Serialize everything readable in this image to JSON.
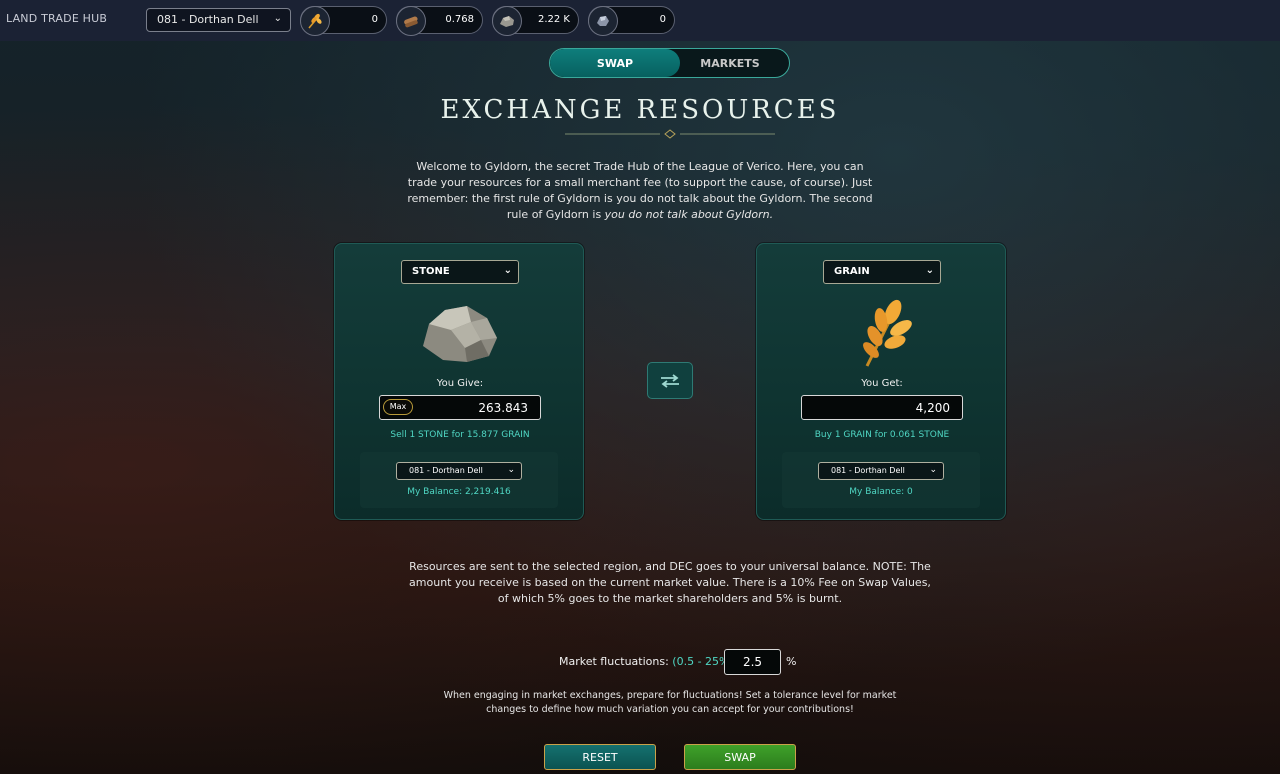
{
  "header": {
    "brand": "LAND TRADE HUB",
    "region_select": "081 - Dorthan Dell",
    "resources": [
      {
        "icon": "grain-icon",
        "value": "0"
      },
      {
        "icon": "wood-icon",
        "value": "0.768"
      },
      {
        "icon": "stone-icon",
        "value": "2.22 K"
      },
      {
        "icon": "iron-icon",
        "value": "0"
      }
    ]
  },
  "tabs": {
    "swap": "SWAP",
    "markets": "MARKETS",
    "active": "SWAP"
  },
  "title": "EXCHANGE RESOURCES",
  "intro": {
    "text": "Welcome to Gyldorn, the secret Trade Hub of the League of Verico. Here, you can trade your resources for a small merchant fee (to support the cause, of course). Just remember: the first rule of Gyldorn is you do not talk about the Gyldorn. The second rule of Gyldorn is ",
    "emphasis": "you do not talk about Gyldorn."
  },
  "give": {
    "resource": "STONE",
    "label": "You Give:",
    "max_label": "Max",
    "amount": "263.843",
    "rate": "Sell 1 STONE for 15.877 GRAIN",
    "region": "081 - Dorthan Dell",
    "balance": "My Balance: 2,219.416"
  },
  "get": {
    "resource": "GRAIN",
    "label": "You Get:",
    "amount": "4,200",
    "rate": "Buy 1 GRAIN for 0.061 STONE",
    "region": "081 - Dorthan Dell",
    "balance": "My Balance: 0"
  },
  "notice": "Resources are sent to the selected region, and DEC goes to your universal balance. NOTE: The amount you receive is based on the current market value. There is a 10% Fee on Swap Values, of which 5% goes to the market shareholders and 5% is burnt.",
  "fluctuation": {
    "label": "Market fluctuations:",
    "range": "(0.5 - 25%)",
    "value": "2.5",
    "unit": "%"
  },
  "tolerance_text": "When engaging in market exchanges, prepare for fluctuations! Set a tolerance level for market changes to define how much variation you can accept for your contributions!",
  "buttons": {
    "reset": "RESET",
    "swap": "SWAP"
  },
  "colors": {
    "accent": "#4fd6c3",
    "panel": "#143c3a",
    "swap_green": "#3fa12a",
    "header": "#1b2234"
  }
}
